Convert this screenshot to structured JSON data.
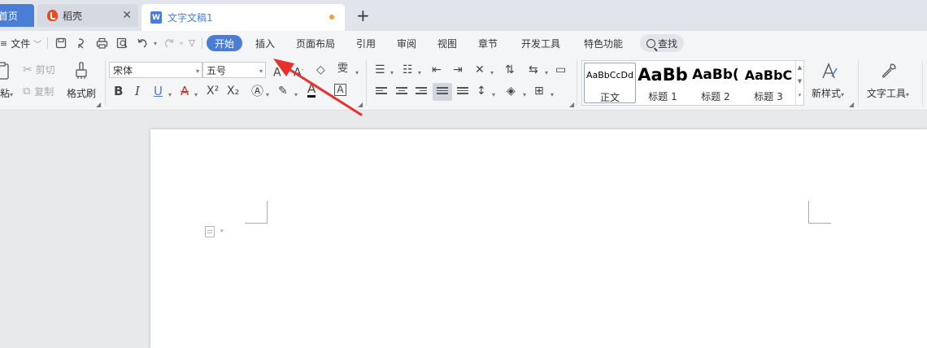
{
  "tabs": {
    "home_label": "首页",
    "daoke_label": "稻壳",
    "doc_label": "文字文稿1",
    "doc_icon_glyph": "W",
    "close_glyph": "✕",
    "new_tab_glyph": "+"
  },
  "menubar": {
    "file_label": "文件",
    "items": [
      "开始",
      "插入",
      "页面布局",
      "引用",
      "审阅",
      "视图",
      "章节",
      "开发工具",
      "特色功能"
    ],
    "search_label": "查找"
  },
  "ribbon": {
    "paste_label": "粘",
    "cut_label": "剪切",
    "copy_label": "复制",
    "format_painter_label": "格式刷",
    "font_name": "宋体",
    "font_size": "五号",
    "bold": "B",
    "italic": "I",
    "underline": "U",
    "superscript": "X²",
    "subscript": "X₂",
    "styles": [
      {
        "sample": "AaBbCcDd",
        "name": "正文"
      },
      {
        "sample": "AaBb",
        "name": "标题 1"
      },
      {
        "sample": "AaBb(",
        "name": "标题 2"
      },
      {
        "sample": "AaBbC",
        "name": "标题 3"
      }
    ],
    "new_style_label": "新样式",
    "text_tool_label": "文字工具"
  },
  "colors": {
    "accent": "#4a7ed6",
    "unsaved_dot": "#f29c38",
    "annotation_arrow": "#e8302c"
  }
}
